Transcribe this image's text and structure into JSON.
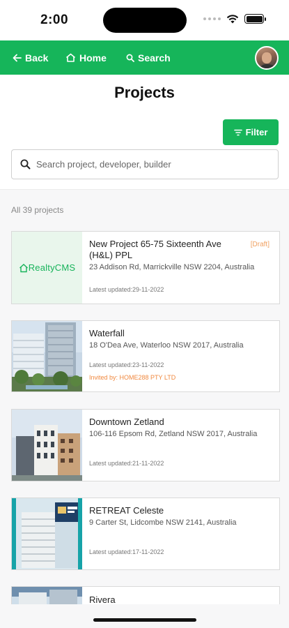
{
  "status_bar": {
    "time": "2:00"
  },
  "nav": {
    "back_label": "Back",
    "home_label": "Home",
    "search_label": "Search",
    "accent_color": "#16b55a"
  },
  "page": {
    "title": "Projects",
    "filter_label": "Filter",
    "search_placeholder": "Search project, developer, builder",
    "count_label": "All 39 projects"
  },
  "projects": [
    {
      "title": "New Project 65-75 Sixteenth Ave (H&L) PPL",
      "badge": "[Draft]",
      "address": "23 Addison Rd, Marrickville NSW 2204, Australia",
      "updated": "Latest updated:29-11-2022",
      "thumb_logo": "RealtyCMS"
    },
    {
      "title": "Waterfall",
      "address": "18 O'Dea Ave, Waterloo NSW 2017, Australia",
      "updated": "Latest updated:23-11-2022",
      "invited": "Invited by: HOME288 PTY LTD"
    },
    {
      "title": "Downtown Zetland",
      "address": "106-116 Epsom Rd, Zetland NSW 2017, Australia",
      "updated": "Latest updated:21-11-2022"
    },
    {
      "title": "RETREAT Celeste",
      "address": "9 Carter St, Lidcombe NSW 2141, Australia",
      "updated": "Latest updated:17-11-2022"
    },
    {
      "title": "Rivera"
    }
  ]
}
